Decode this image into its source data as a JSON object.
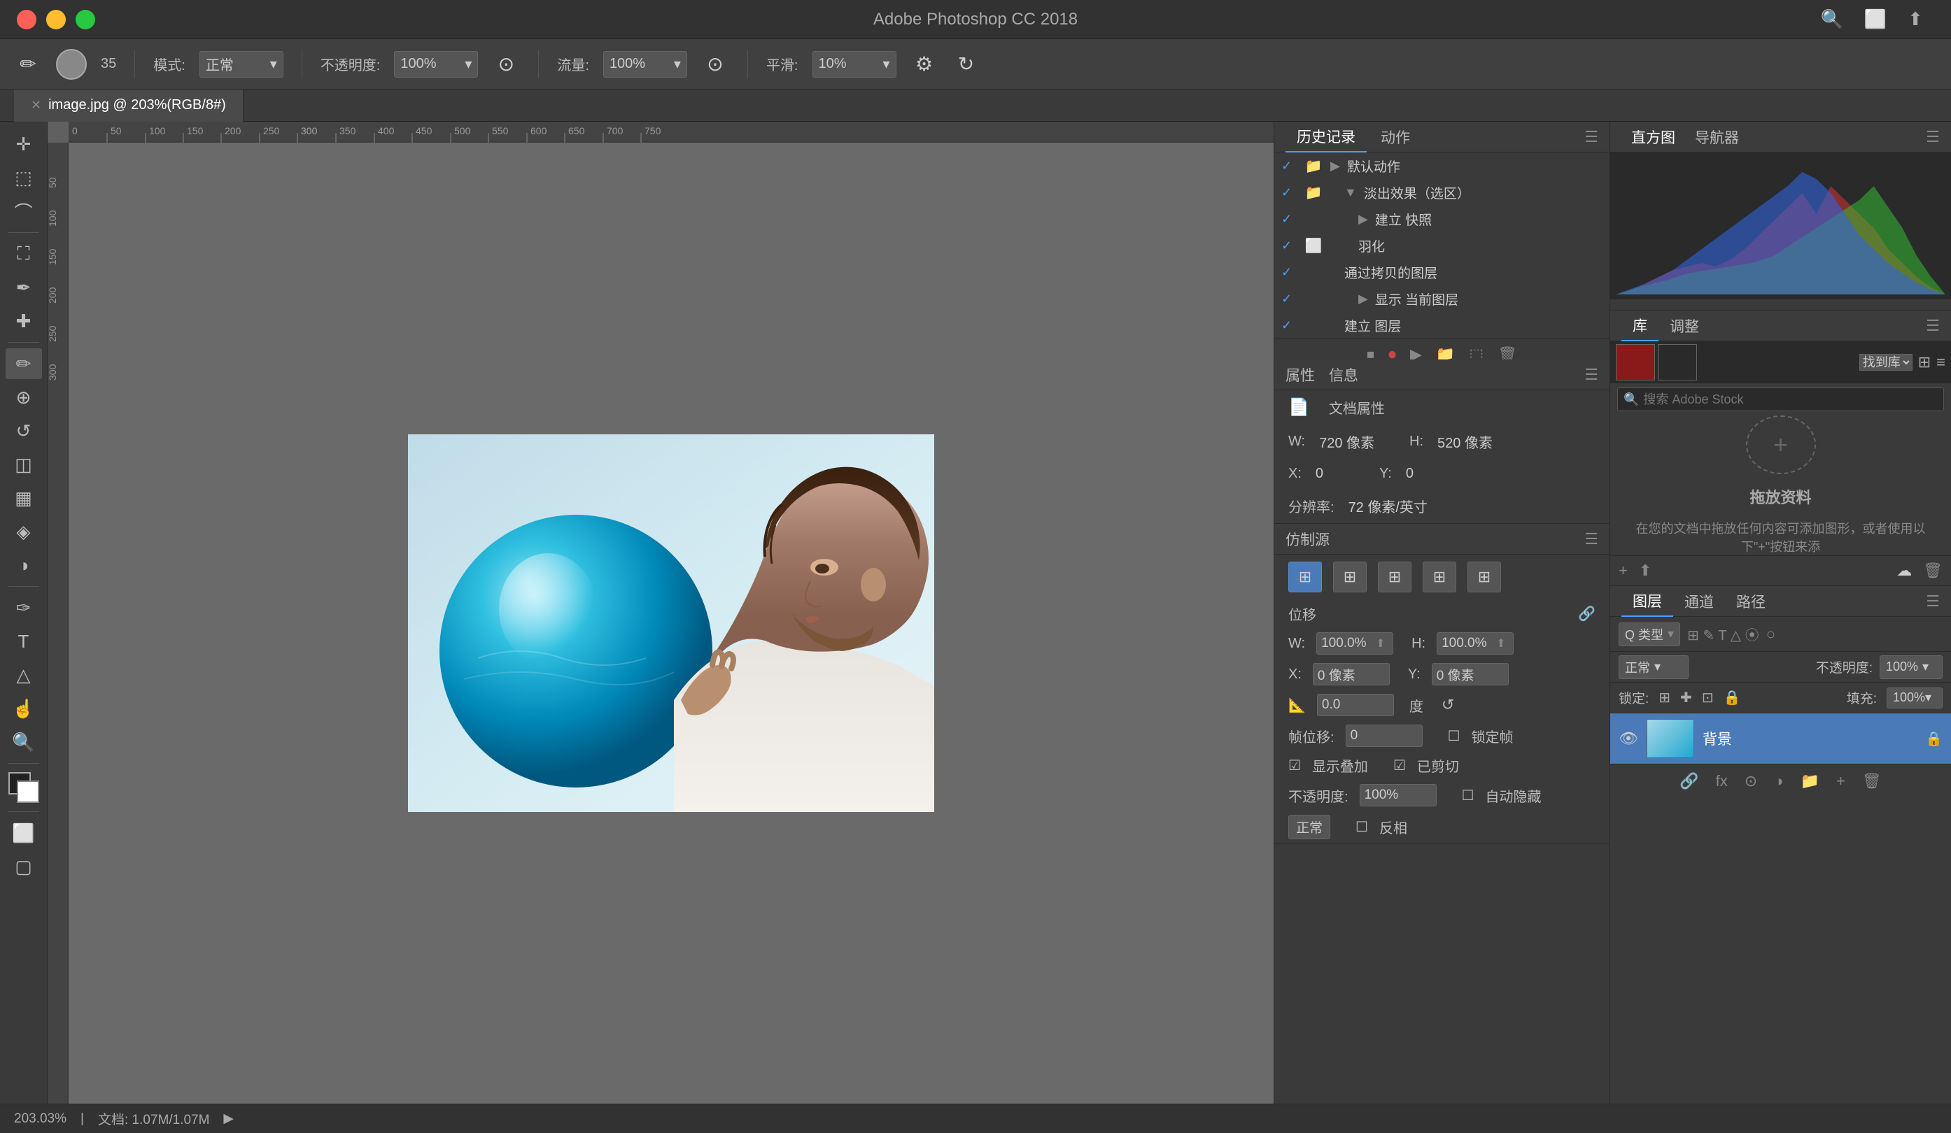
{
  "app": {
    "title": "Adobe Photoshop CC 2018"
  },
  "titlebar": {
    "title": "Adobe Photoshop CC 2018",
    "search_icon": "🔍",
    "window_icon": "⬜",
    "share_icon": "↑"
  },
  "toolbar": {
    "brush_icon": "✏",
    "size_num": "35",
    "mode_label": "模式:",
    "mode_value": "正常",
    "opacity_label": "不透明度:",
    "opacity_value": "100%",
    "flow_label": "流量:",
    "flow_value": "100%",
    "smooth_label": "平滑:",
    "smooth_value": "10%"
  },
  "tab": {
    "name": "image.jpg @ 203%(RGB/8#)",
    "close": "✕"
  },
  "history_panel": {
    "tabs": [
      "历史记录",
      "动作"
    ],
    "active_tab": "历史记录",
    "items": [
      {
        "checked": true,
        "has_folder": true,
        "indent": 0,
        "has_expand": false,
        "text": "默认动作",
        "icon_type": "folder"
      },
      {
        "checked": true,
        "has_folder": true,
        "indent": 1,
        "has_expand": true,
        "text": "淡出效果（选区）",
        "icon_type": "folder"
      },
      {
        "checked": true,
        "has_folder": false,
        "indent": 2,
        "has_expand": true,
        "text": "建立 快照",
        "icon_type": "none"
      },
      {
        "checked": true,
        "has_folder": true,
        "indent": 2,
        "has_expand": false,
        "text": "羽化",
        "icon_type": "small_rect"
      },
      {
        "checked": true,
        "has_folder": false,
        "indent": 1,
        "has_expand": false,
        "text": "通过拷贝的图层",
        "icon_type": "none"
      },
      {
        "checked": true,
        "has_folder": false,
        "indent": 2,
        "has_expand": true,
        "text": "显示 当前图层",
        "icon_type": "none"
      },
      {
        "checked": true,
        "has_folder": false,
        "indent": 1,
        "has_expand": false,
        "text": "建立 图层",
        "icon_type": "none"
      }
    ]
  },
  "properties_panel": {
    "title": "属性",
    "info_tab": "信息",
    "doc_props_label": "文档属性",
    "width_label": "W:",
    "width_val": "720 像素",
    "height_label": "H:",
    "height_val": "520 像素",
    "x_label": "X:",
    "x_val": "0",
    "y_label": "Y:",
    "y_val": "0",
    "resolution_label": "分辨率:",
    "resolution_val": "72 像素/英寸"
  },
  "clone_panel": {
    "title": "仿制源",
    "buttons": [
      "⊞",
      "⊞",
      "⊞",
      "⊞",
      "⊞"
    ],
    "offset_label": "位移",
    "w_label": "W:",
    "w_val": "100.0%",
    "h_label": "H:",
    "h_val": "100.0%",
    "x_label": "X:",
    "x_val": "0 像素",
    "y_label": "Y:",
    "y_val": "0 像素",
    "rotation_label": "",
    "rotation_val": "0.0",
    "rotation_unit": "度",
    "frame_label": "帧位移:",
    "frame_val": "0",
    "lock_frame_label": "锁定帧",
    "show_overlay_label": "显示叠加",
    "clipped_label": "已剪切",
    "opacity_label": "不透明度:",
    "opacity_val": "100%",
    "auto_hide_label": "自动隐藏",
    "normal_label": "正常",
    "invert_label": "反相"
  },
  "histogram_panel": {
    "tabs": [
      "直方图",
      "导航器"
    ],
    "active": "直方图"
  },
  "library_panel": {
    "tabs": [
      "库",
      "调整"
    ],
    "search_placeholder": "搜索 Adobe Stock",
    "drop_title": "拖放资料",
    "drop_desc": "在您的文档中拖放任何内容可添加图形，或者使用以下\"+\"按钮来添"
  },
  "layers_panel": {
    "tabs": [
      "图层",
      "通道",
      "路径"
    ],
    "active": "图层",
    "type_placeholder": "Q 类型",
    "mode_val": "正常",
    "opacity_label": "不透明度:",
    "opacity_val": "100%",
    "lock_label": "锁定:",
    "fill_label": "填充:",
    "fill_val": "100%",
    "layer_name": "背景"
  },
  "statusbar": {
    "zoom": "203.03%",
    "doc_size_label": "文档: 1.07M/1.07M",
    "arrow": "▶"
  }
}
